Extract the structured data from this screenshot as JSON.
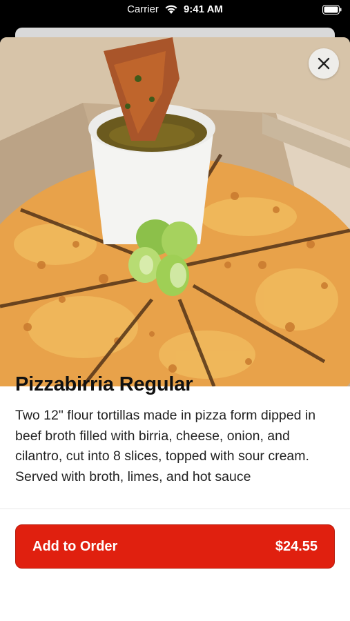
{
  "status_bar": {
    "carrier": "Carrier",
    "time": "9:41 AM",
    "wifi_icon": "wifi-icon",
    "battery_icon": "battery-icon"
  },
  "item": {
    "title": "Pizzabirria Regular",
    "description": "Two 12\" flour tortillas made in pizza form dipped in beef broth filled with birria, cheese, onion, and cilantro, cut into 8 slices, topped with sour cream. Served with broth, limes, and hot sauce",
    "image_icon": "food-photo"
  },
  "close_icon": "close-icon",
  "order_button": {
    "label": "Add to Order",
    "price": "$24.55"
  },
  "colors": {
    "accent": "#e0200f",
    "status_bar": "#000000"
  }
}
